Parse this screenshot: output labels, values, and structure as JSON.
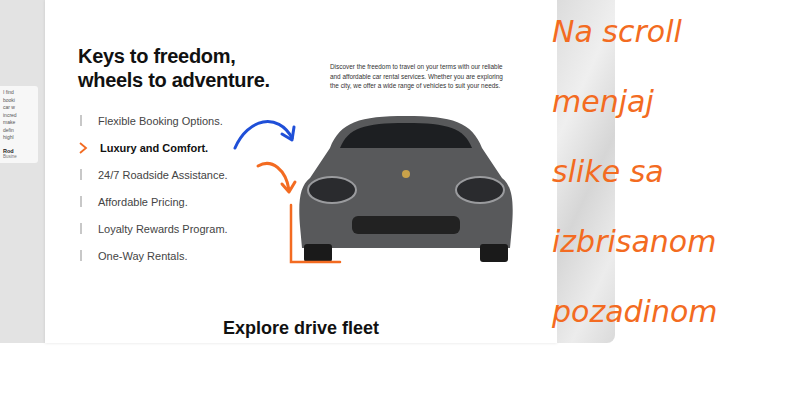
{
  "side_card": {
    "lines": [
      "I find",
      "booki",
      "car w",
      "incred",
      "make",
      "defin",
      "highl"
    ],
    "author": "Rod",
    "role": "Busine"
  },
  "hero": {
    "title": "Keys to freedom, wheels to adventure.",
    "description": "Discover the freedom to travel on your terms with our reliable and affordable car rental services. Whether you are exploring the city, we offer a wide range of vehicles to suit your needs."
  },
  "features": [
    {
      "label": "Flexible Booking Options.",
      "selected": false
    },
    {
      "label": "Luxury and Comfort.",
      "selected": true
    },
    {
      "label": "24/7 Roadside Assistance.",
      "selected": false
    },
    {
      "label": "Affordable Pricing.",
      "selected": false
    },
    {
      "label": "Loyalty Rewards Program.",
      "selected": false
    },
    {
      "label": "One-Way Rentals.",
      "selected": false
    }
  ],
  "section_title": "Explore drive fleet",
  "annotations": {
    "note_lines": [
      "Na scroll",
      "menjaj",
      "slike sa",
      "izbrisanom",
      "pozadinom"
    ],
    "arrows": [
      {
        "color": "#1f4fd8"
      },
      {
        "color": "#f36b21"
      }
    ],
    "note_color": "#f36b21"
  }
}
